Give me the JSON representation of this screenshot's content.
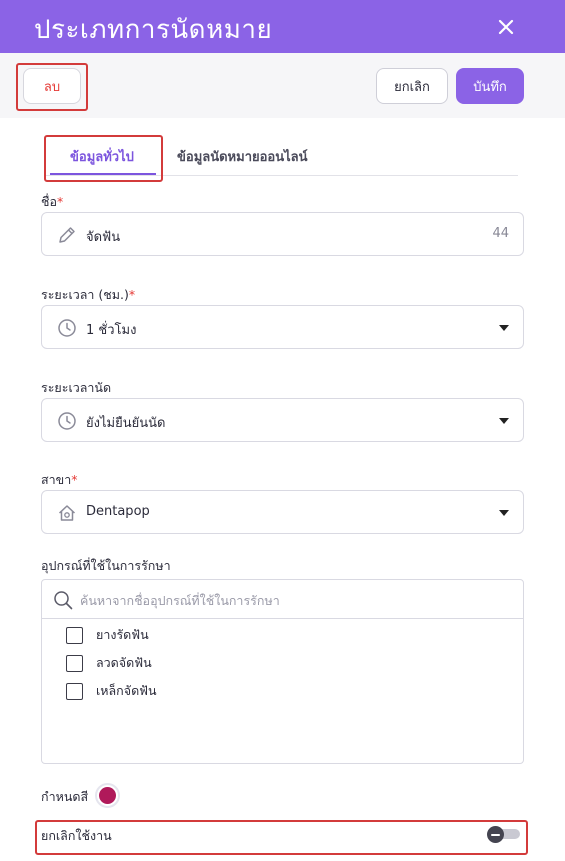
{
  "header": {
    "title": "ประเภทการนัดหมาย",
    "close_icon": "close-icon"
  },
  "toolbar": {
    "delete_label": "ลบ",
    "cancel_label": "ยกเลิก",
    "save_label": "บันทึก"
  },
  "tabs": [
    {
      "label": "ข้อมูลทั่วไป",
      "active": true
    },
    {
      "label": "ข้อมูลนัดหมายออนไลน์",
      "active": false
    }
  ],
  "form": {
    "name": {
      "label": "ชื่อ",
      "required_mark": "*",
      "value": "จัดฟัน",
      "counter": "44",
      "icon": "pencil-icon"
    },
    "duration": {
      "label": "ระยะเวลา (ชม.)",
      "required_mark": "*",
      "value": "1 ชั่วโมง",
      "icon": "clock-icon"
    },
    "appointment_duration": {
      "label": "ระยะเวลานัด",
      "value": "ยังไม่ยืนยันนัด",
      "icon": "clock-icon"
    },
    "branch": {
      "label": "สาขา",
      "required_mark": "*",
      "value": "Dentapop",
      "icon": "home-icon"
    },
    "equipment": {
      "label": "อุปกรณ์ที่ใช้ในการรักษา",
      "search_placeholder": "ค้นหาจากชื่ออุปกรณ์ที่ใช้ในการรักษา",
      "items": [
        {
          "label": "ยางรัดฟัน",
          "checked": false
        },
        {
          "label": "ลวดจัดฟัน",
          "checked": false
        },
        {
          "label": "เหล็กจัดฟัน",
          "checked": false
        }
      ]
    },
    "color": {
      "label": "กำหนดสี",
      "value": "#b0195a"
    },
    "disable": {
      "label": "ยกเลิกใช้งาน",
      "enabled": false
    }
  },
  "colors": {
    "accent": "#8b63e6",
    "highlight": "#d33b3b",
    "danger": "#e53935"
  }
}
